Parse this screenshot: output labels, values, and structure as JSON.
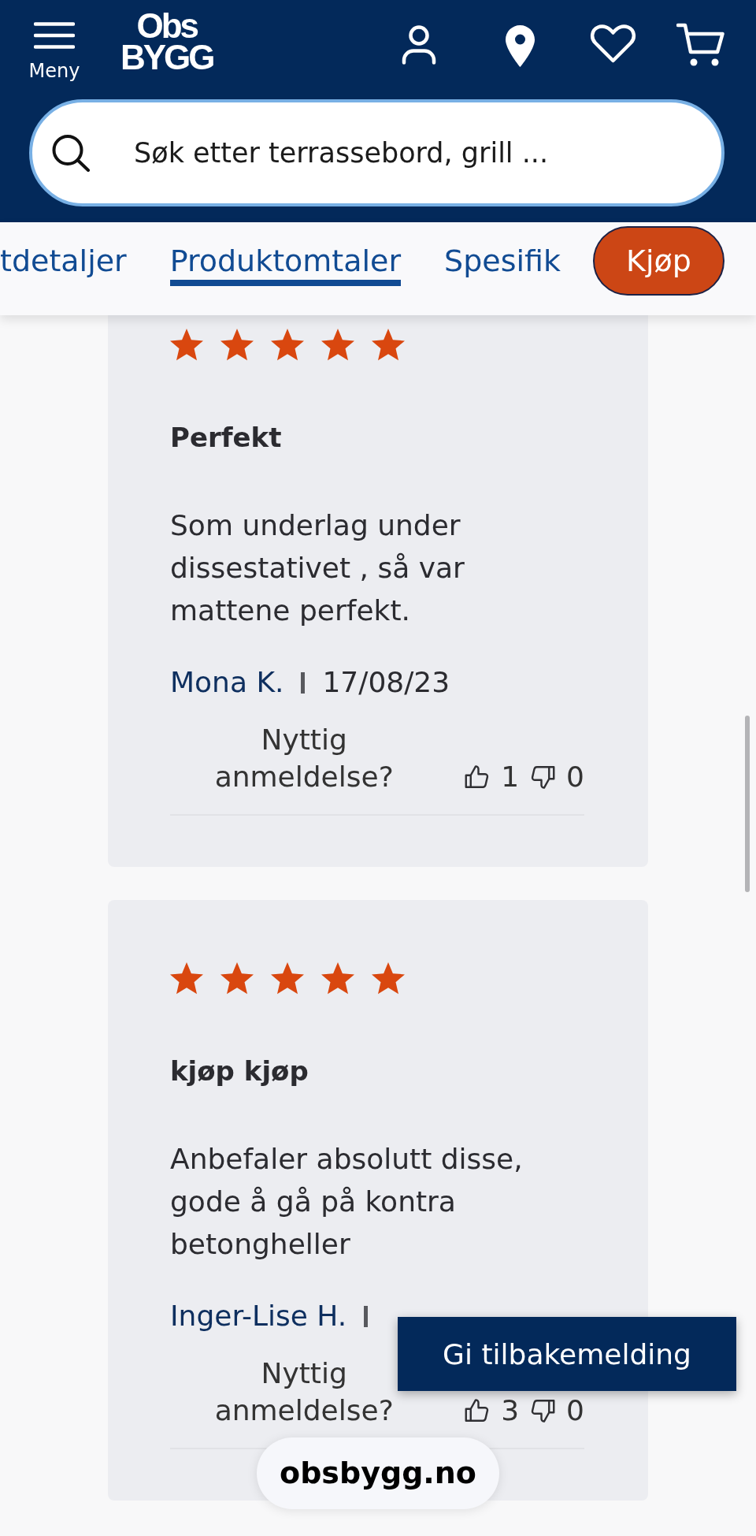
{
  "header": {
    "menu_label": "Meny",
    "logo": [
      "Obs",
      "BYGG"
    ]
  },
  "search": {
    "placeholder": "Søk etter terrassebord, grill ..."
  },
  "tabs": [
    {
      "label": "tdetaljer",
      "selected": false
    },
    {
      "label": "Produktomtaler",
      "selected": true
    },
    {
      "label": "Spesifik",
      "selected": false
    }
  ],
  "buy_button": {
    "label": "Kjøp"
  },
  "reviews": [
    {
      "stars": 5,
      "title": "Perfekt",
      "text": "Som underlag under dissestativet , så var mattene perfekt.",
      "author": "Mona K.",
      "date": "17/08/23",
      "helpful_prompt": "Nyttig anmeldelse?",
      "helpful_votes": "1",
      "unhelpful_votes": "0"
    },
    {
      "stars": 5,
      "title": "kjøp kjøp",
      "text": "Anbefaler absolutt disse, gode å gå på kontra betongheller",
      "author": "Inger-Lise H.",
      "helpful_prompt": "Nyttig anmeldelse?",
      "helpful_votes": "3",
      "unhelpful_votes": "0"
    }
  ],
  "feedback_button": {
    "label": "Gi tilbakemelding"
  },
  "address_bar": {
    "url": "obsbygg.no"
  }
}
